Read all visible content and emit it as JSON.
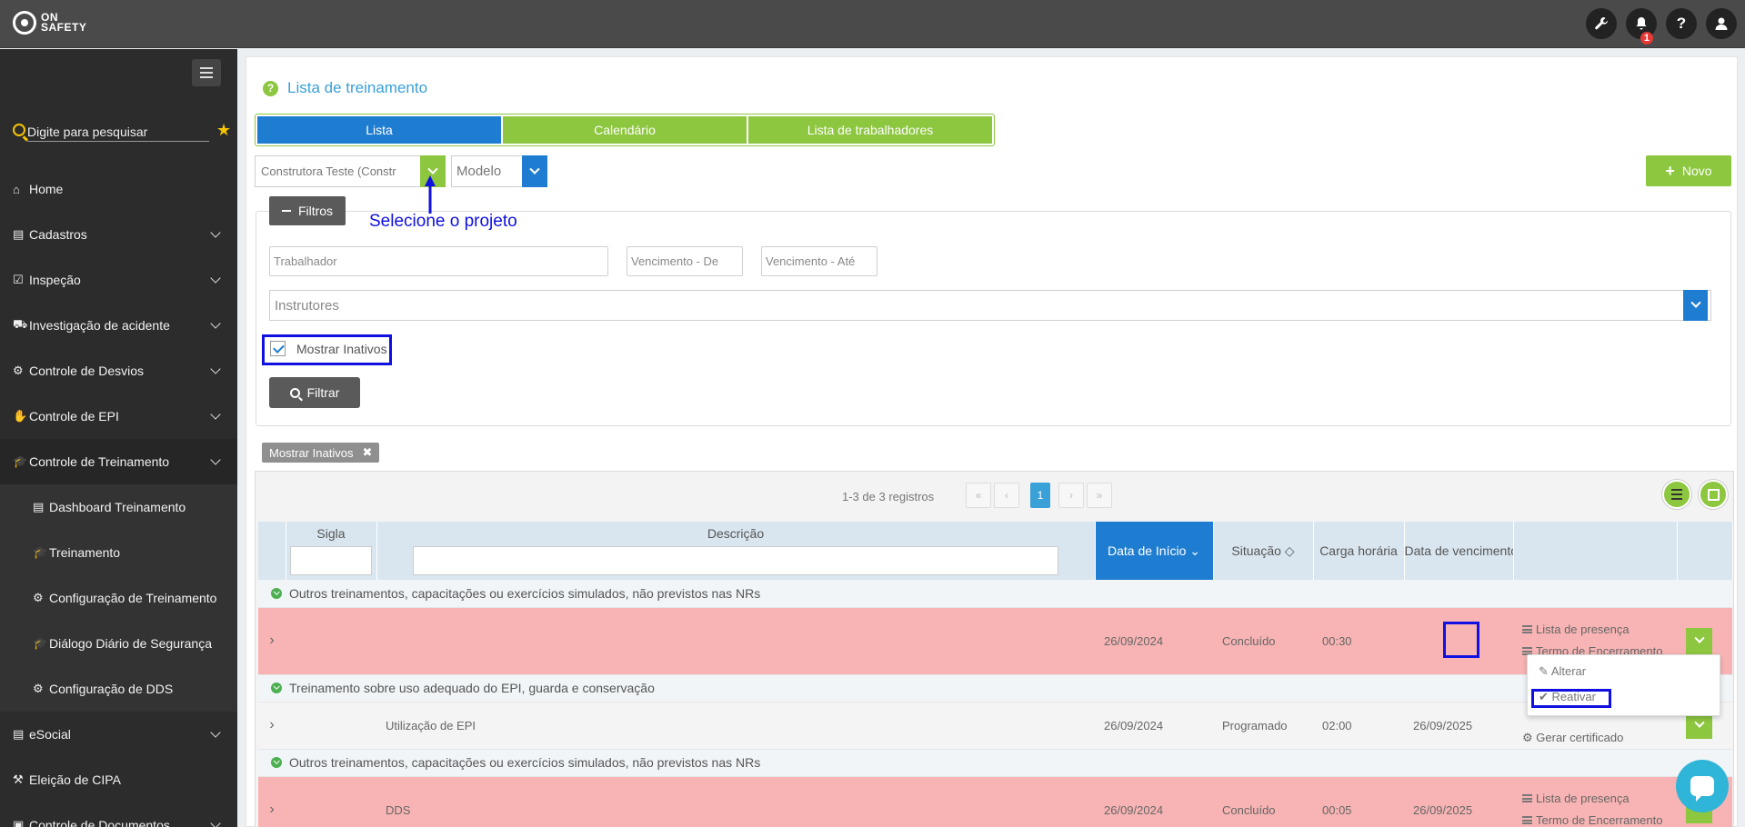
{
  "app": {
    "logo_line1": "ON",
    "logo_line2": "SAFETY"
  },
  "topbar": {
    "icons": [
      "wrench-icon",
      "bell-icon",
      "help-icon",
      "user-icon"
    ],
    "notification_count": "1"
  },
  "sidebar": {
    "search_placeholder": "Digite para pesquisar",
    "items": [
      {
        "label": "Home",
        "icon": "home-icon"
      },
      {
        "label": "Cadastros",
        "icon": "calendar-icon"
      },
      {
        "label": "Inspeção",
        "icon": "check-square-icon"
      },
      {
        "label": "Investigação de acidente",
        "icon": "ambulance-icon"
      },
      {
        "label": "Controle de Desvios",
        "icon": "gear-icon"
      },
      {
        "label": "Controle de EPI",
        "icon": "hand-icon"
      },
      {
        "label": "Controle de Treinamento",
        "icon": "graduation-cap-icon"
      },
      {
        "label": "Dashboard Treinamento",
        "icon": "calendar-icon"
      },
      {
        "label": "Treinamento",
        "icon": "graduation-cap-icon"
      },
      {
        "label": "Configuração de Treinamento",
        "icon": "gears-icon"
      },
      {
        "label": "Diálogo Diário de Segurança",
        "icon": "graduation-cap-icon"
      },
      {
        "label": "Configuração de DDS",
        "icon": "gears-icon"
      },
      {
        "label": "eSocial",
        "icon": "calendar-icon"
      },
      {
        "label": "Eleição de CIPA",
        "icon": "gavel-icon"
      },
      {
        "label": "Controle de Documentos",
        "icon": "folder-icon"
      }
    ]
  },
  "page": {
    "title": "Lista de treinamento",
    "tabs": [
      "Lista",
      "Calendário",
      "Lista de trabalhadores"
    ],
    "project_value": "Construtora Teste (Constr",
    "model_placeholder": "Modelo",
    "new_label": "Novo",
    "annotation_project": "Selecione o projeto"
  },
  "filters": {
    "toggle_label": "Filtros",
    "worker_placeholder": "Trabalhador",
    "due_from_placeholder": "Vencimento - De",
    "due_to_placeholder": "Vencimento - Até",
    "instructors_placeholder": "Instrutores",
    "show_inactive_label": "Mostrar Inativos",
    "filter_button": "Filtrar",
    "active_chip": "Mostrar Inativos"
  },
  "grid": {
    "records_text": "1-3 de 3 registros",
    "page_current": "1",
    "columns": [
      "Sigla",
      "Descrição",
      "Data de Início",
      "Situação",
      "Carga horária",
      "Data de vencimento"
    ],
    "groups": [
      {
        "label": "Outros treinamentos, capacitações ou exercícios simulados, não previstos nas NRs",
        "row": {
          "sigla": "",
          "descricao": "",
          "inicio": "26/09/2024",
          "situacao": "Concluído",
          "carga": "00:30",
          "vencimento": "",
          "actions": [
            "Lista de presença",
            "Termo de Encerramento"
          ]
        }
      },
      {
        "label": "Treinamento sobre uso adequado do EPI, guarda e conservação",
        "row": {
          "sigla": "",
          "descricao": "Utilização de EPI",
          "inicio": "26/09/2024",
          "situacao": "Programado",
          "carga": "02:00",
          "vencimento": "26/09/2025",
          "actions": [
            "Gerar certificado"
          ]
        }
      },
      {
        "label": "Outros treinamentos, capacitações ou exercícios simulados, não previstos nas NRs",
        "row": {
          "sigla": "",
          "descricao": "DDS",
          "inicio": "26/09/2024",
          "situacao": "Concluído",
          "carga": "00:05",
          "vencimento": "26/09/2025",
          "actions": [
            "Lista de presença",
            "Termo de Encerramento"
          ]
        }
      }
    ],
    "dropdown": {
      "alter": "Alterar",
      "reactivate": "Reativar"
    }
  },
  "colors": {
    "brand_green": "#8dc63f",
    "brand_blue": "#1f7dd1",
    "annotation_blue": "#1010e0",
    "inactive_row": "#f8b4b4"
  }
}
